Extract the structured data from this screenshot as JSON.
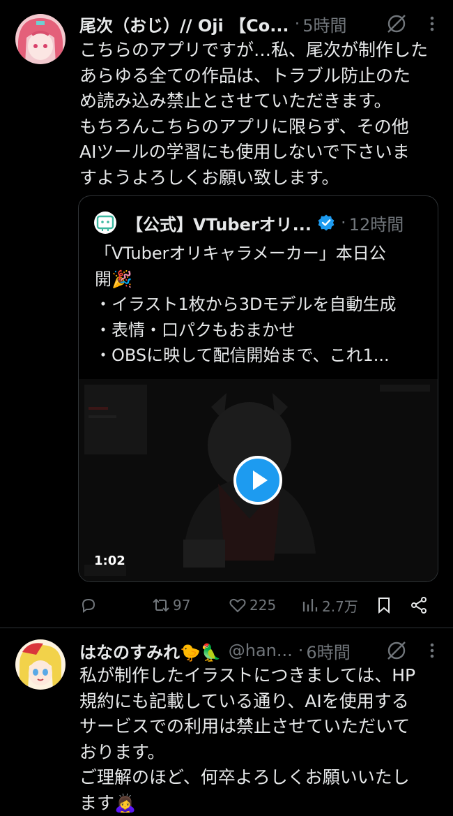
{
  "tweets": [
    {
      "display_name": "尾次（おじ）// Oji 【Co...",
      "time": "5時間",
      "text_lines": [
        "こちらのアプリですが…私、尾次が制作した",
        "あらゆる全ての作品は、トラブル防止のた",
        "め読み込み禁止とさせていただきます。",
        "もちろんこちらのアプリに限らず、その他",
        "AIツールの学習にも使用しないで下さいま",
        "すようよろしくお願い致します。"
      ],
      "quote": {
        "display_name": "【公式】VTuberオリ...",
        "time": "12時間",
        "text_lines": [
          "「VTuberオリキャラメーカー」本日公",
          "開🎉",
          "・イラスト1枚から3Dモデルを自動生成",
          "・表情・口パクもおまかせ",
          "・OBSに映して配信開始まで、これ1..."
        ],
        "video_duration": "1:02"
      },
      "actions": {
        "reply": "",
        "retweet": "97",
        "like": "225",
        "views": "2.7万"
      }
    },
    {
      "display_name": "はなのすみれ🐤🦜",
      "handle": "@han...",
      "time": "6時間",
      "text_lines": [
        "私が制作したイラストにつきましては、HP",
        "規約にも記載している通り、AIを使用する",
        "サービスでの利用は禁止させていただいて",
        "おります。",
        "ご理解のほど、何卒よろしくお願いいたし",
        "ます🙇‍♀️"
      ]
    }
  ],
  "colors": {
    "background": "#000000",
    "text": "#e7e9ea",
    "muted": "#71767b",
    "accent": "#1d9bf0",
    "border": "#2f3336"
  },
  "icons": [
    "grok-icon",
    "more-icon",
    "verified-icon",
    "play-icon",
    "reply-icon",
    "retweet-icon",
    "like-icon",
    "views-icon",
    "bookmark-icon",
    "share-icon"
  ]
}
